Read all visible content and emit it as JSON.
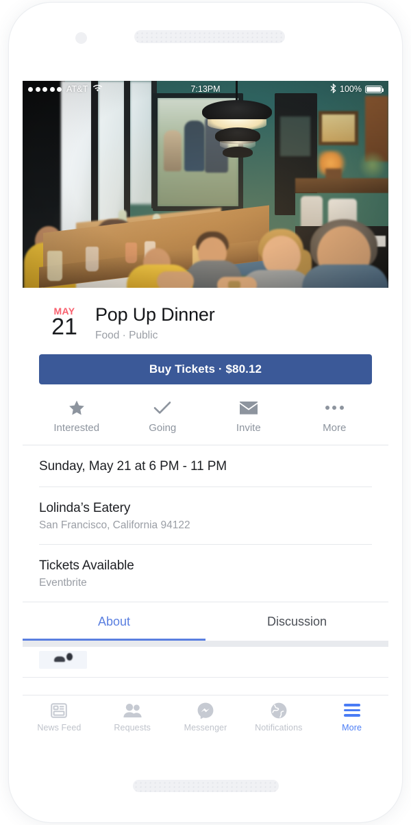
{
  "device": {
    "frame_color": "#ffffff",
    "camera_icon": "camera-dot",
    "speaker_icon": "speaker-grille"
  },
  "status_bar": {
    "signal_dots": 5,
    "carrier": "AT&T",
    "wifi_icon": "wifi-icon",
    "time": "7:13PM",
    "bluetooth_icon": "bluetooth-icon",
    "battery_percent": "100%",
    "battery_icon": "battery-full-icon"
  },
  "hero": {
    "alt": "Diners seated along a long communal wooden table inside a restaurant with teal walls and a pendant lamp"
  },
  "event": {
    "date_month": "MAY",
    "date_day": "21",
    "title": "Pop Up Dinner",
    "subtitle": "Food · Public",
    "month_color": "#f8606e"
  },
  "cta": {
    "buy_label": "Buy Tickets · $80.12",
    "color": "#3b5998"
  },
  "actions": [
    {
      "label": "Interested",
      "icon": "star-icon"
    },
    {
      "label": "Going",
      "icon": "check-icon"
    },
    {
      "label": "Invite",
      "icon": "envelope-icon"
    },
    {
      "label": "More",
      "icon": "ellipsis-icon"
    }
  ],
  "details": [
    {
      "title": "Sunday, May 21 at 6 PM - 11 PM",
      "sub": ""
    },
    {
      "title": "Lolinda’s Eatery",
      "sub": "San Francisco, California 94122"
    },
    {
      "title": "Tickets Available",
      "sub": "Eventbrite"
    }
  ],
  "tabs": [
    {
      "label": "About",
      "active": true
    },
    {
      "label": "Discussion",
      "active": false
    }
  ],
  "bottom_nav": [
    {
      "label": "News Feed",
      "icon": "news-feed-icon",
      "active": false
    },
    {
      "label": "Requests",
      "icon": "friend-requests-icon",
      "active": false
    },
    {
      "label": "Messenger",
      "icon": "messenger-icon",
      "active": false
    },
    {
      "label": "Notifications",
      "icon": "globe-icon",
      "active": false
    },
    {
      "label": "More",
      "icon": "hamburger-icon",
      "active": true
    }
  ],
  "colors": {
    "accent_blue": "#4a7cf5",
    "tab_active": "#5a7fe0",
    "icon_gray": "#8d949e",
    "nav_gray": "#bfc3cb"
  }
}
